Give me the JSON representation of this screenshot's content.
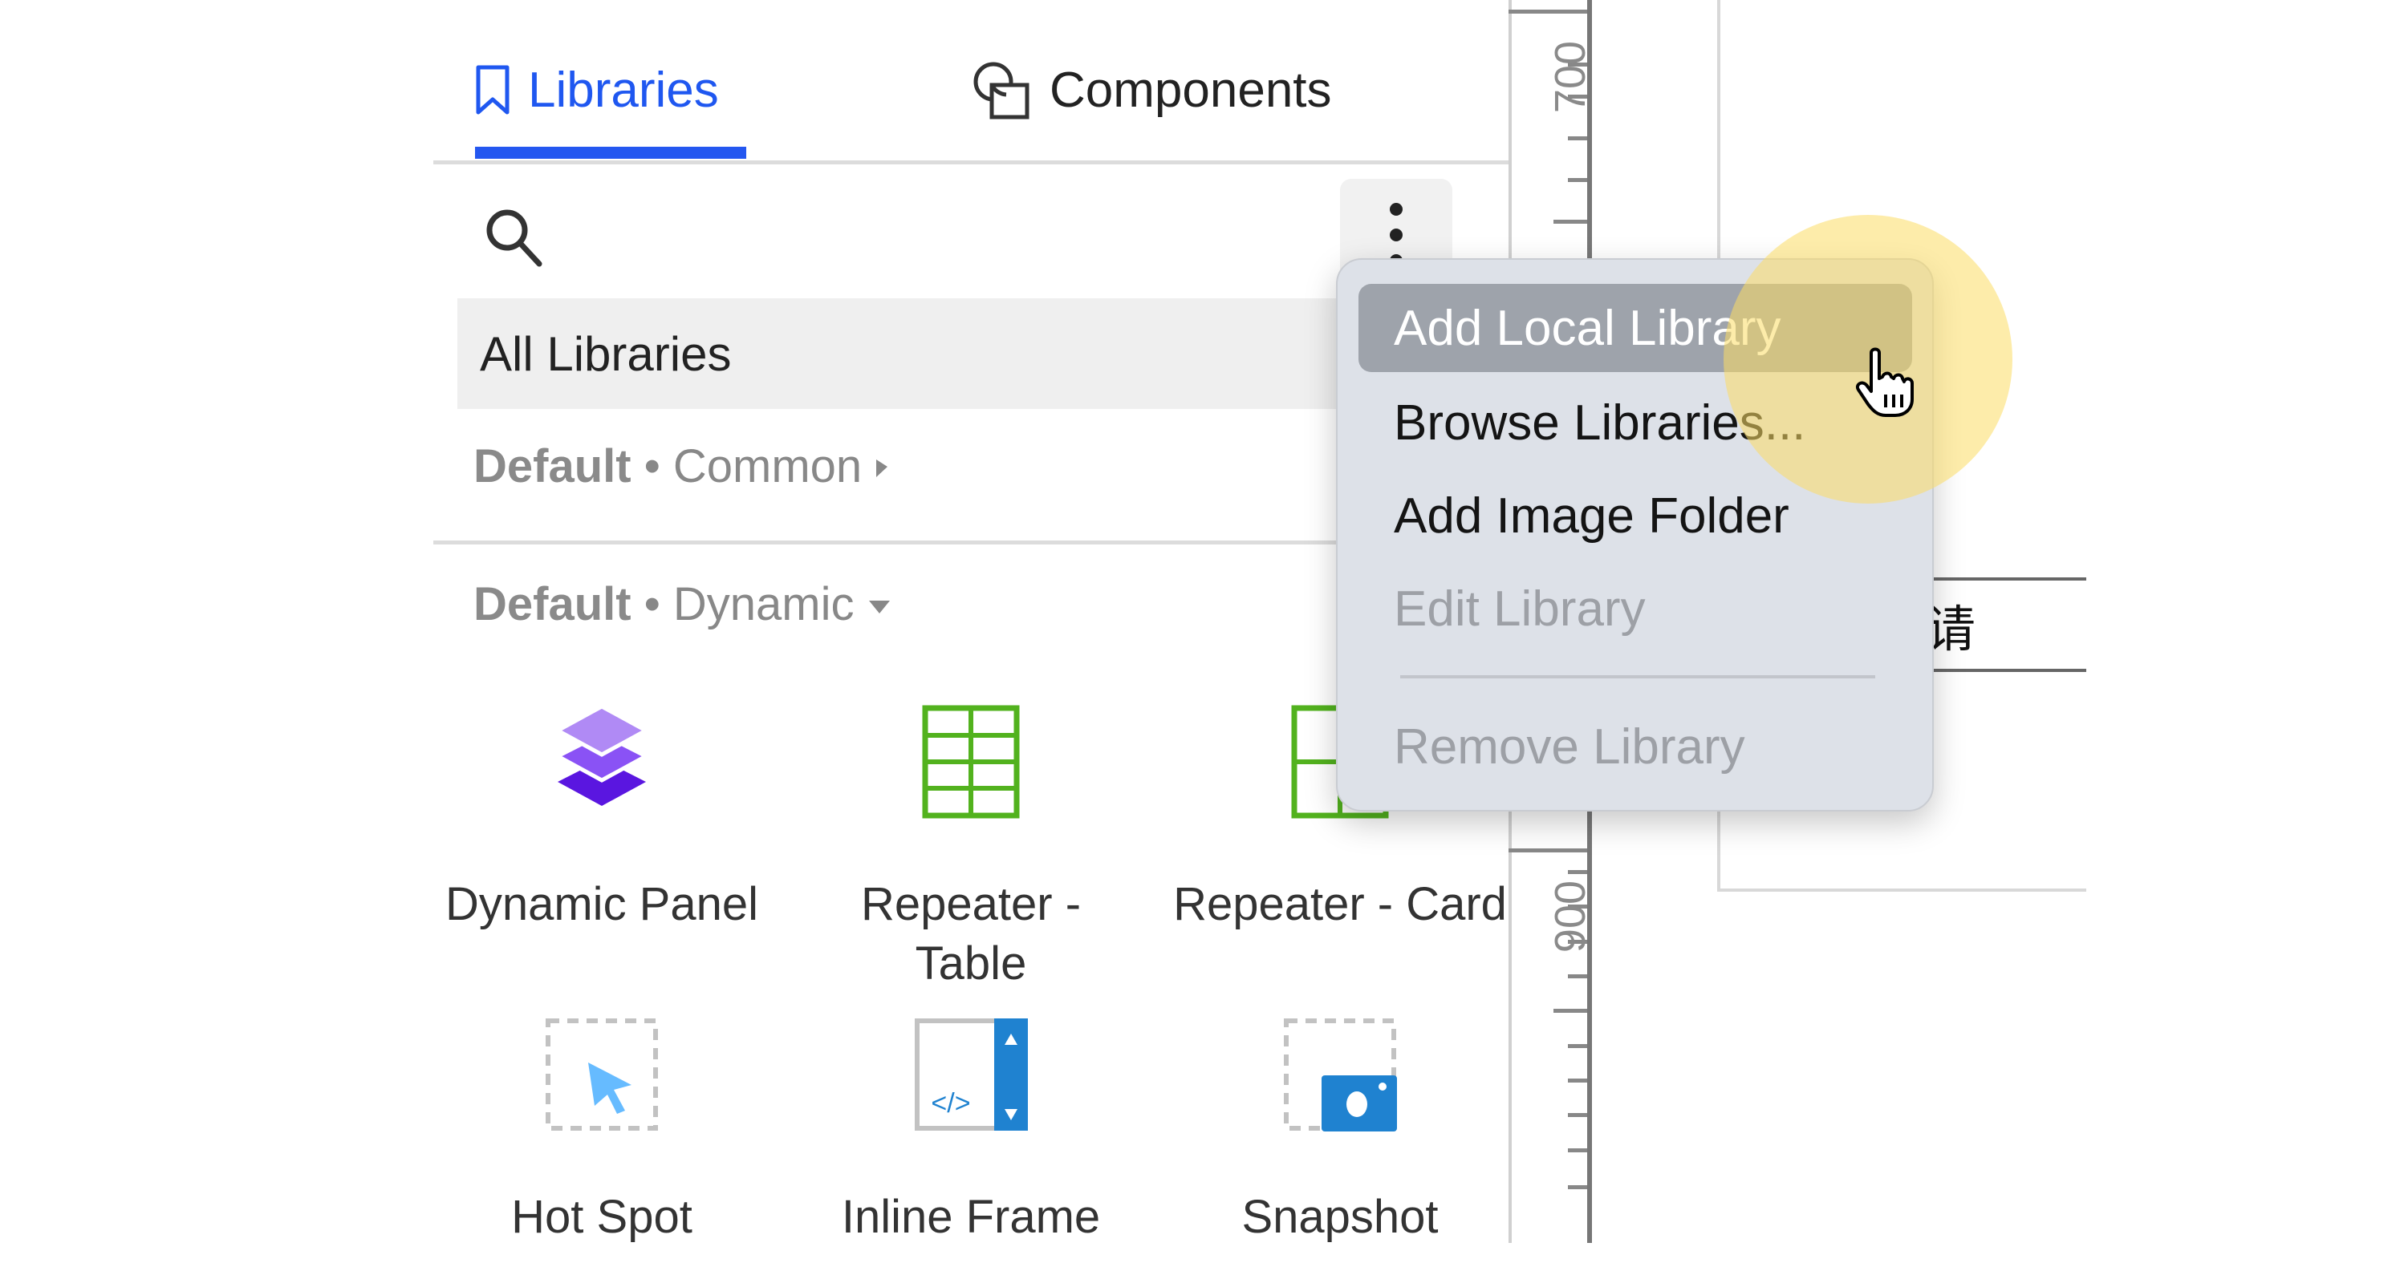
{
  "tabs": [
    {
      "label": "Libraries",
      "icon": "bookmark-icon",
      "active": true
    },
    {
      "label": "Components",
      "icon": "components-icon",
      "active": false
    }
  ],
  "search": {
    "icon": "search-icon",
    "more_icon": "more-vertical-icon"
  },
  "library_selector": {
    "selected": "All Libraries"
  },
  "sections": [
    {
      "library": "Default",
      "separator": "•",
      "category": "Common",
      "state": "collapsed"
    },
    {
      "library": "Default",
      "separator": "•",
      "category": "Dynamic",
      "state": "expanded"
    }
  ],
  "widgets": [
    {
      "label": "Dynamic Panel",
      "icon": "dynamic-panel-icon"
    },
    {
      "label": "Repeater - Table",
      "icon": "repeater-table-icon"
    },
    {
      "label": "Repeater - Card",
      "icon": "repeater-card-icon"
    },
    {
      "label": "Hot Spot",
      "icon": "hot-spot-icon"
    },
    {
      "label": "Inline Frame",
      "icon": "inline-frame-icon"
    },
    {
      "label": "Snapshot",
      "icon": "snapshot-icon"
    }
  ],
  "ruler": {
    "labels": [
      "700",
      "900"
    ]
  },
  "canvas": {
    "partial_text": "请"
  },
  "context_menu": {
    "items": [
      {
        "label": "Add Local Library",
        "state": "highlighted"
      },
      {
        "label": "Browse Libraries...",
        "state": "enabled"
      },
      {
        "label": "Add Image Folder",
        "state": "enabled"
      },
      {
        "label": "Edit Library",
        "state": "disabled"
      },
      {
        "label": "Remove Library",
        "state": "disabled"
      }
    ]
  },
  "colors": {
    "accent": "#2457f0",
    "menu_bg": "#dde1e8",
    "menu_highlight": "#9ea3ab",
    "repeater_green": "#52b21e",
    "dynamic_purple": "#6a28e8",
    "frame_blue": "#1f82d0",
    "cursor_halo": "#fcdc64"
  }
}
